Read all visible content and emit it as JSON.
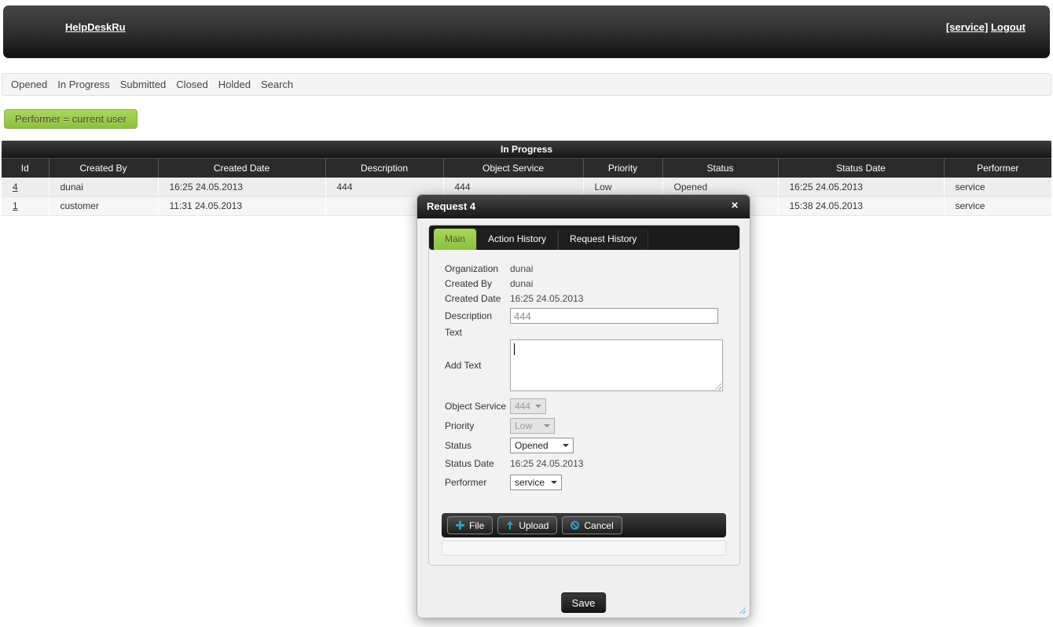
{
  "header": {
    "brand": "HelpDeskRu",
    "user_link": "[service]",
    "logout": "Logout"
  },
  "nav": {
    "items": [
      "Opened",
      "In Progress",
      "Submitted",
      "Closed",
      "Holded",
      "Search"
    ]
  },
  "filter": {
    "label": "Performer = current user"
  },
  "table": {
    "title": "In Progress",
    "columns": [
      "Id",
      "Created By",
      "Created Date",
      "Description",
      "Object Service",
      "Priority",
      "Status",
      "Status Date",
      "Performer"
    ],
    "rows": [
      [
        "4",
        "dunai",
        "16:25 24.05.2013",
        "444",
        "444",
        "Low",
        "Opened",
        "16:25 24.05.2013",
        "service"
      ],
      [
        "1",
        "customer",
        "11:31 24.05.2013",
        "",
        "",
        "",
        "",
        "15:38 24.05.2013",
        "service"
      ]
    ]
  },
  "dialog": {
    "title": "Request 4",
    "tabs": [
      "Main",
      "Action History",
      "Request History"
    ],
    "active_tab": "Main",
    "fields": {
      "organization": {
        "label": "Organization",
        "value": "dunai"
      },
      "created_by": {
        "label": "Created By",
        "value": "dunai"
      },
      "created_date": {
        "label": "Created Date",
        "value": "16:25 24.05.2013"
      },
      "description": {
        "label": "Description",
        "value": "444"
      },
      "text": {
        "label": "Text",
        "value": ""
      },
      "add_text": {
        "label": "Add Text",
        "value": ""
      },
      "object_service": {
        "label": "Object Service",
        "value": "444",
        "disabled": true
      },
      "priority": {
        "label": "Priority",
        "value": "Low",
        "disabled": true
      },
      "status": {
        "label": "Status",
        "value": "Opened",
        "disabled": false
      },
      "status_date": {
        "label": "Status Date",
        "value": "16:25 24.05.2013"
      },
      "performer": {
        "label": "Performer",
        "value": "service",
        "disabled": false
      }
    },
    "upload_toolbar": {
      "file": "File",
      "upload": "Upload",
      "cancel": "Cancel"
    },
    "save": "Save"
  },
  "icons": {
    "close": "×"
  },
  "colors": {
    "accent_green": "#97c94a",
    "icon_blue": "#2d9fc0",
    "dark_bar": "#1c1c1c"
  }
}
